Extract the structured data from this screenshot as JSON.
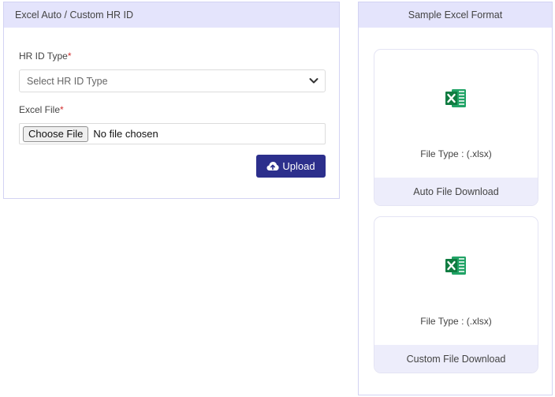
{
  "left_panel": {
    "title": "Excel Auto / Custom HR ID",
    "hr_id_type": {
      "label": "HR ID Type",
      "required_mark": "*",
      "placeholder": "Select HR ID Type"
    },
    "excel_file": {
      "label": "Excel File",
      "required_mark": "*",
      "choose_label": "Choose File",
      "status": "No file chosen"
    },
    "upload_label": "Upload"
  },
  "right_panel": {
    "title": "Sample Excel Format",
    "cards": [
      {
        "file_type": "File Type : (.xlsx)",
        "download_label": "Auto File Download",
        "icon": "excel-icon"
      },
      {
        "file_type": "File Type : (.xlsx)",
        "download_label": "Custom File Download",
        "icon": "excel-icon"
      }
    ]
  },
  "colors": {
    "accent": "#2c2f8c",
    "header_bg": "#e4e4fc",
    "excel_green": "#21a366"
  }
}
